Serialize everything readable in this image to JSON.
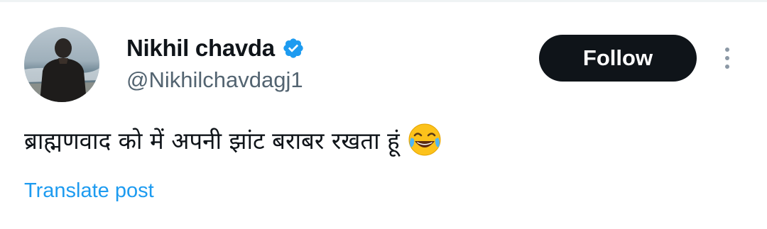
{
  "author": {
    "display_name": "Nikhil chavda",
    "handle": "@Nikhilchavdagj1",
    "verified_icon": "verified-badge-icon",
    "avatar_icon": "profile-photo"
  },
  "actions": {
    "follow_label": "Follow",
    "more_icon": "more-options-icon"
  },
  "post": {
    "text": "ब्राह्मणवाद को में अपनी झांट बराबर रखता हूं",
    "emoji": "face-with-tears-of-joy",
    "translate_label": "Translate post"
  },
  "colors": {
    "text_primary": "#0f1419",
    "text_secondary": "#536471",
    "link": "#1d9bf0",
    "verified": "#1d9bf0",
    "follow_bg": "#0f1419"
  }
}
